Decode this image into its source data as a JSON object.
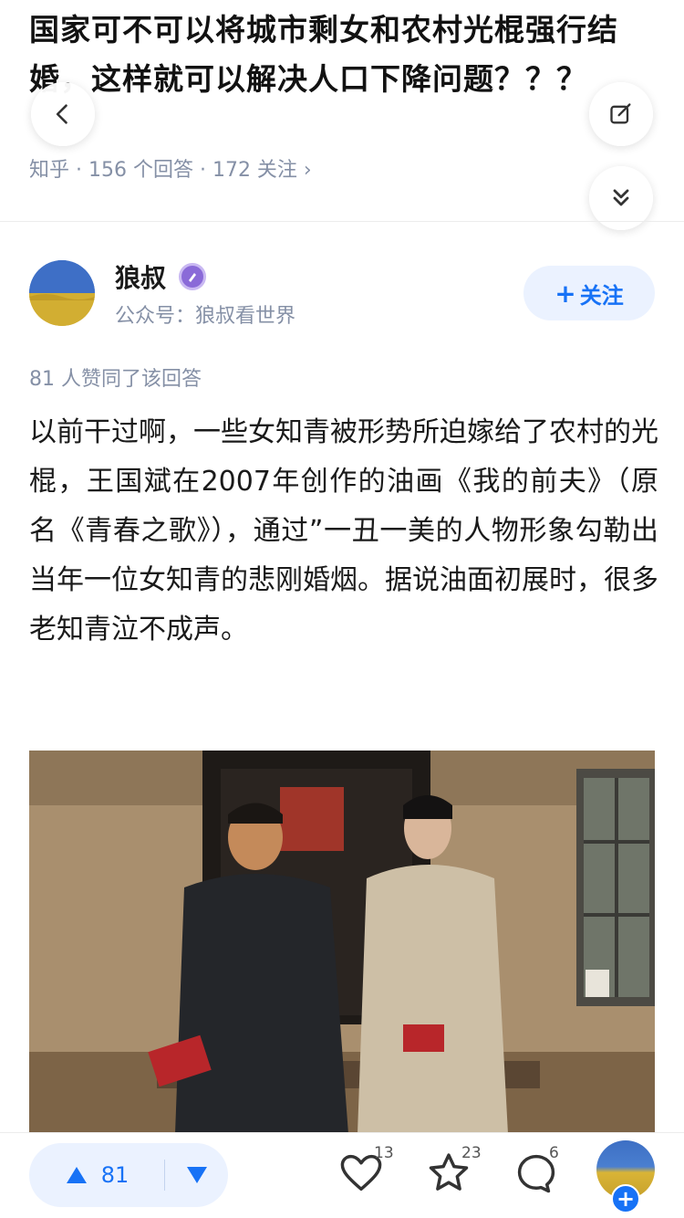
{
  "question": {
    "title": "国家可不可以将城市剩女和农村光棍强行结婚，这样就可以解决人口下降问题？？？",
    "meta": "知乎 · 156 个回答 · 172 关注 ›"
  },
  "author": {
    "name": "狼叔",
    "description": "公众号：狼叔看世界",
    "follow_label": "关注"
  },
  "answer": {
    "vote_info": "81 人赞同了该回答",
    "text": "以前干过啊，一些女知青被形势所迫嫁给了农村的光棍，王国斌在2007年创作的油画《我的前夫》（原名《青春之歌》），通过”一丑一美的人物形象勾勒出当年一位女知青的悲刚婚烟。据说油面初展时，很多老知青泣不成声。"
  },
  "bottom_bar": {
    "upvote_count": "81",
    "like_count": "13",
    "favorite_count": "23",
    "comment_count": "6"
  },
  "colors": {
    "accent": "#1772f6",
    "accent_bg": "#ebf2ff",
    "meta_gray": "#8590a6"
  }
}
